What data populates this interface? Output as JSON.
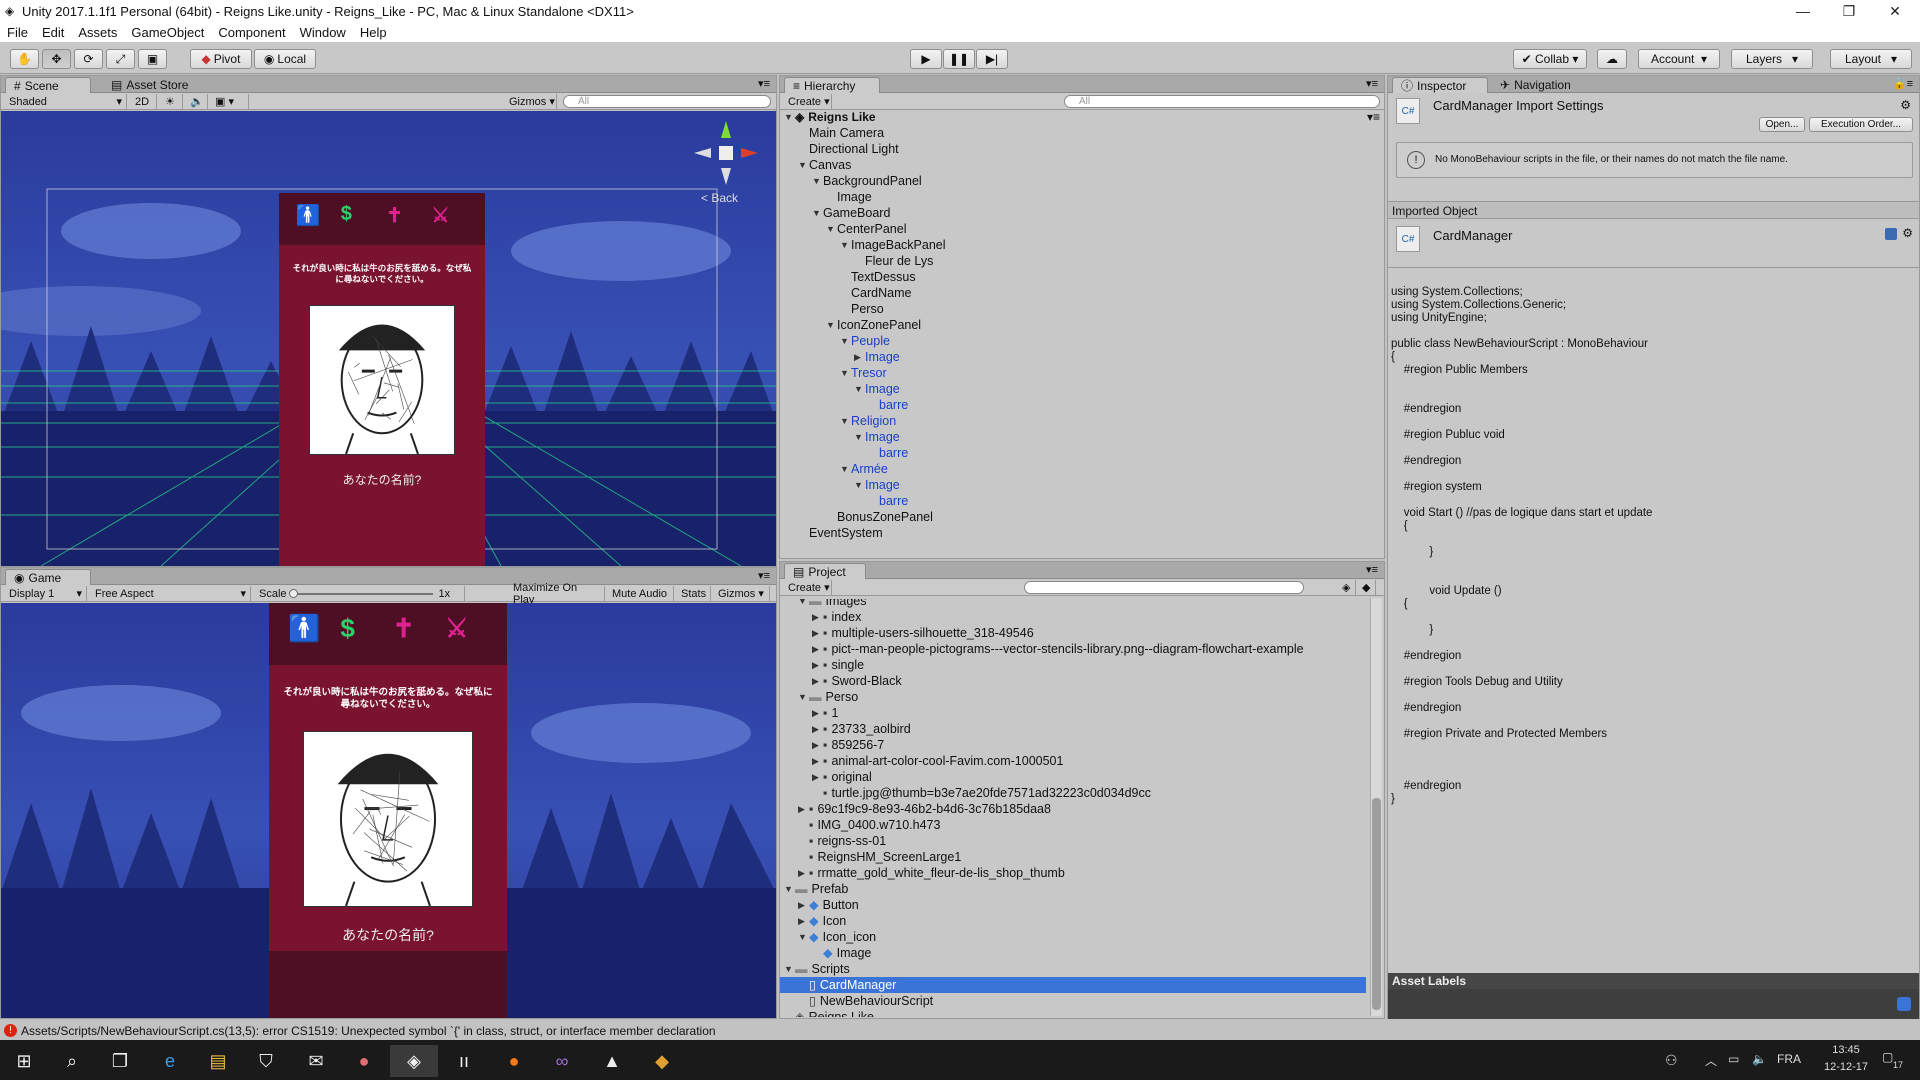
{
  "window": {
    "title": "Unity 2017.1.1f1 Personal (64bit) - Reigns Like.unity - Reigns_Like - PC, Mac & Linux Standalone <DX11>"
  },
  "menu": [
    "File",
    "Edit",
    "Assets",
    "GameObject",
    "Component",
    "Window",
    "Help"
  ],
  "toolbar": {
    "pivot": "Pivot",
    "local": "Local",
    "collab": "Collab",
    "account": "Account",
    "layers": "Layers",
    "layout": "Layout"
  },
  "scene": {
    "tabs": [
      "Scene",
      "Asset Store"
    ],
    "shading": "Shaded",
    "mode2d": "2D",
    "gizmos": "Gizmos",
    "search_placeholder": "All",
    "back": "< Back"
  },
  "card": {
    "text": "それが良い時に私は牛のお尻を舐める。なぜ私に尋ねないでください。",
    "name": "あなたの名前?",
    "icons": [
      "person-icon",
      "dollar-icon",
      "cross-icon",
      "sword-icon"
    ]
  },
  "game": {
    "tab": "Game",
    "display": "Display 1",
    "aspect": "Free Aspect",
    "scale_label": "Scale",
    "scale_value": "1x",
    "maximize": "Maximize On Play",
    "mute": "Mute Audio",
    "stats": "Stats",
    "gizmos": "Gizmos"
  },
  "hierarchy": {
    "tab": "Hierarchy",
    "create": "Create",
    "search_placeholder": "All",
    "scene": "Reigns Like",
    "items": [
      {
        "label": "Main Camera",
        "depth": 1,
        "arrow": "",
        "blue": false
      },
      {
        "label": "Directional Light",
        "depth": 1,
        "arrow": "",
        "blue": false
      },
      {
        "label": "Canvas",
        "depth": 1,
        "arrow": "down",
        "blue": false
      },
      {
        "label": "BackgroundPanel",
        "depth": 2,
        "arrow": "down",
        "blue": false
      },
      {
        "label": "Image",
        "depth": 3,
        "arrow": "",
        "blue": false
      },
      {
        "label": "GameBoard",
        "depth": 2,
        "arrow": "down",
        "blue": false
      },
      {
        "label": "CenterPanel",
        "depth": 3,
        "arrow": "down",
        "blue": false
      },
      {
        "label": "ImageBackPanel",
        "depth": 4,
        "arrow": "down",
        "blue": false
      },
      {
        "label": "Fleur de Lys",
        "depth": 5,
        "arrow": "",
        "blue": false
      },
      {
        "label": "TextDessus",
        "depth": 4,
        "arrow": "",
        "blue": false
      },
      {
        "label": "CardName",
        "depth": 4,
        "arrow": "",
        "blue": false
      },
      {
        "label": "Perso",
        "depth": 4,
        "arrow": "",
        "blue": false
      },
      {
        "label": "IconZonePanel",
        "depth": 3,
        "arrow": "down",
        "blue": false
      },
      {
        "label": "Peuple",
        "depth": 4,
        "arrow": "down",
        "blue": true
      },
      {
        "label": "Image",
        "depth": 5,
        "arrow": "right",
        "blue": true
      },
      {
        "label": "Tresor",
        "depth": 4,
        "arrow": "down",
        "blue": true
      },
      {
        "label": "Image",
        "depth": 5,
        "arrow": "down",
        "blue": true
      },
      {
        "label": "barre",
        "depth": 6,
        "arrow": "",
        "blue": true
      },
      {
        "label": "Religion",
        "depth": 4,
        "arrow": "down",
        "blue": true
      },
      {
        "label": "Image",
        "depth": 5,
        "arrow": "down",
        "blue": true
      },
      {
        "label": "barre",
        "depth": 6,
        "arrow": "",
        "blue": true
      },
      {
        "label": "Armée",
        "depth": 4,
        "arrow": "down",
        "blue": true
      },
      {
        "label": "Image",
        "depth": 5,
        "arrow": "down",
        "blue": true
      },
      {
        "label": "barre",
        "depth": 6,
        "arrow": "",
        "blue": true
      },
      {
        "label": "BonusZonePanel",
        "depth": 3,
        "arrow": "",
        "blue": false
      },
      {
        "label": "EventSystem",
        "depth": 1,
        "arrow": "",
        "blue": false
      }
    ]
  },
  "project": {
    "tab": "Project",
    "create": "Create",
    "items": [
      {
        "label": "Images",
        "depth": 1,
        "arrow": "down",
        "icon": "folder-icon",
        "sel": false
      },
      {
        "label": "index",
        "depth": 2,
        "arrow": "right",
        "icon": "image-icon",
        "sel": false
      },
      {
        "label": "multiple-users-silhouette_318-49546",
        "depth": 2,
        "arrow": "right",
        "icon": "image-icon",
        "sel": false
      },
      {
        "label": "pict--man-people-pictograms---vector-stencils-library.png--diagram-flowchart-example",
        "depth": 2,
        "arrow": "right",
        "icon": "image-icon",
        "sel": false
      },
      {
        "label": "single",
        "depth": 2,
        "arrow": "right",
        "icon": "image-icon",
        "sel": false
      },
      {
        "label": "Sword-Black",
        "depth": 2,
        "arrow": "right",
        "icon": "image-icon",
        "sel": false
      },
      {
        "label": "Perso",
        "depth": 1,
        "arrow": "down",
        "icon": "folder-icon",
        "sel": false
      },
      {
        "label": "1",
        "depth": 2,
        "arrow": "right",
        "icon": "image-icon",
        "sel": false
      },
      {
        "label": "23733_aolbird",
        "depth": 2,
        "arrow": "right",
        "icon": "image-icon",
        "sel": false
      },
      {
        "label": "859256-7",
        "depth": 2,
        "arrow": "right",
        "icon": "image-icon",
        "sel": false
      },
      {
        "label": "animal-art-color-cool-Favim.com-1000501",
        "depth": 2,
        "arrow": "right",
        "icon": "image-icon",
        "sel": false
      },
      {
        "label": "original",
        "depth": 2,
        "arrow": "right",
        "icon": "image-icon",
        "sel": false
      },
      {
        "label": "turtle.jpg@thumb=b3e7ae20fde7571ad32223c0d034d9cc",
        "depth": 2,
        "arrow": "",
        "icon": "image-icon",
        "sel": false
      },
      {
        "label": "69c1f9c9-8e93-46b2-b4d6-3c76b185daa8",
        "depth": 1,
        "arrow": "right",
        "icon": "image-icon",
        "sel": false
      },
      {
        "label": "IMG_0400.w710.h473",
        "depth": 1,
        "arrow": "",
        "icon": "image-icon",
        "sel": false
      },
      {
        "label": "reigns-ss-01",
        "depth": 1,
        "arrow": "",
        "icon": "image-icon",
        "sel": false
      },
      {
        "label": "ReignsHM_ScreenLarge1",
        "depth": 1,
        "arrow": "",
        "icon": "image-icon",
        "sel": false
      },
      {
        "label": "rrmatte_gold_white_fleur-de-lis_shop_thumb",
        "depth": 1,
        "arrow": "right",
        "icon": "image-icon",
        "sel": false
      },
      {
        "label": "Prefab",
        "depth": 0,
        "arrow": "down",
        "icon": "folder-icon",
        "sel": false
      },
      {
        "label": "Button",
        "depth": 1,
        "arrow": "right",
        "icon": "prefab-icon",
        "sel": false
      },
      {
        "label": "Icon",
        "depth": 1,
        "arrow": "right",
        "icon": "prefab-icon",
        "sel": false
      },
      {
        "label": "Icon_icon",
        "depth": 1,
        "arrow": "down",
        "icon": "prefab-icon",
        "sel": false
      },
      {
        "label": "Image",
        "depth": 2,
        "arrow": "",
        "icon": "prefab-icon",
        "sel": false
      },
      {
        "label": "Scripts",
        "depth": 0,
        "arrow": "down",
        "icon": "folder-icon",
        "sel": false
      },
      {
        "label": "CardManager",
        "depth": 1,
        "arrow": "",
        "icon": "script-icon",
        "sel": true
      },
      {
        "label": "NewBehaviourScript",
        "depth": 1,
        "arrow": "",
        "icon": "script-icon",
        "sel": false
      },
      {
        "label": "Reigns Like",
        "depth": 0,
        "arrow": "",
        "icon": "unity-icon",
        "sel": false
      }
    ]
  },
  "inspector": {
    "tabs": [
      "Inspector",
      "Navigation"
    ],
    "title": "CardManager Import Settings",
    "open": "Open...",
    "exec": "Execution Order...",
    "warning": "No MonoBehaviour scripts in the file, or their names do not match the file name.",
    "imported": "Imported Object",
    "object": "CardManager",
    "asset_labels": "Asset Labels",
    "code": "using System.Collections;\nusing System.Collections.Generic;\nusing UnityEngine;\n\npublic class NewBehaviourScript : MonoBehaviour\n{\n    #region Public Members\n\n\n    #endregion\n\n    #region Publuc void\n\n    #endregion\n\n    #region system\n\n    void Start () //pas de logique dans start et update\n    {\n\n            }\n\n\n            void Update ()\n    {\n\n            }\n\n    #endregion\n\n    #region Tools Debug and Utility\n\n    #endregion\n\n    #region Private and Protected Members\n\n\n\n    #endregion\n}"
  },
  "status": {
    "error": "Assets/Scripts/NewBehaviourScript.cs(13,5): error CS1519: Unexpected symbol `{' in class, struct, or interface member declaration"
  },
  "taskbar": {
    "lang": "FRA",
    "time": "13:45",
    "date": "12-12-17",
    "notif": "17"
  },
  "colors": {
    "accent": "#3b74d7",
    "card": "#7a1330",
    "sky": "#3850b4",
    "grid": "#27d18a",
    "icon_pink": "#e0208f",
    "icon_green": "#2bd26a"
  }
}
